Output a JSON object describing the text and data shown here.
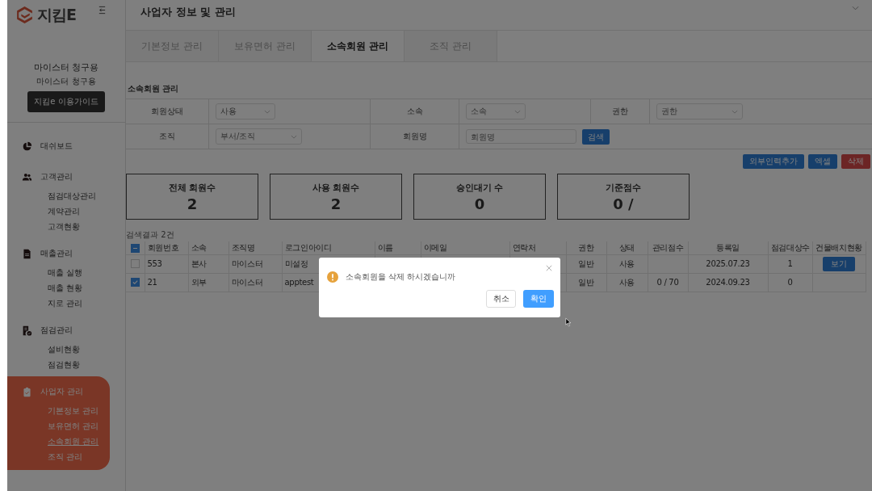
{
  "brand": {
    "name": "지킴E"
  },
  "account": {
    "name": "마이스터 청구용",
    "sub": "마이스터 청구용",
    "guide_button": "지킴e 이용가이드"
  },
  "sidebar": {
    "groups": [
      {
        "label": "대쉬보드",
        "selected": false
      },
      {
        "label": "고객관리",
        "selected": false,
        "children": [
          {
            "label": "점검대상관리",
            "selected": false
          },
          {
            "label": "계약관리",
            "selected": false
          },
          {
            "label": "고객현황",
            "selected": false
          }
        ]
      },
      {
        "label": "매출관리",
        "selected": false,
        "children": [
          {
            "label": "매출 실행",
            "selected": false
          },
          {
            "label": "매출 현황",
            "selected": false
          },
          {
            "label": "지로 관리",
            "selected": false
          }
        ]
      },
      {
        "label": "점검관리",
        "selected": false,
        "children": [
          {
            "label": "설비현황",
            "selected": false
          },
          {
            "label": "점검현황",
            "selected": false
          }
        ]
      },
      {
        "label": "사업자 관리",
        "selected": true,
        "children": [
          {
            "label": "기본정보 관리",
            "selected": false
          },
          {
            "label": "보유면허 관리",
            "selected": false
          },
          {
            "label": "소속회원 관리",
            "selected": true
          },
          {
            "label": "조직 관리",
            "selected": false
          }
        ]
      }
    ]
  },
  "header": {
    "title": "사업자 정보 및 관리"
  },
  "tabs": [
    {
      "label": "기본정보 관리",
      "selected": false
    },
    {
      "label": "보유면허 관리",
      "selected": false
    },
    {
      "label": "소속회원 관리",
      "selected": true
    },
    {
      "label": "조직 관리",
      "selected": false
    }
  ],
  "section_title": "소속회원 관리",
  "filters": [
    [
      {
        "label": "회원상태",
        "kind": "select",
        "value": "사용"
      },
      {
        "label": "소속",
        "kind": "select",
        "placeholder": "소속"
      },
      {
        "label": "권한",
        "kind": "select",
        "placeholder": "권한"
      }
    ],
    [
      {
        "label": "조직",
        "kind": "select",
        "placeholder": "부서/조직"
      },
      {
        "label": "회원명",
        "kind": "input",
        "placeholder": "회원명"
      }
    ]
  ],
  "search_button": "검색",
  "actions": [
    {
      "label": "외부인력추가",
      "kind": "primary"
    },
    {
      "label": "엑셀",
      "kind": "primary"
    },
    {
      "label": "삭제",
      "kind": "danger"
    }
  ],
  "stats": [
    {
      "label": "전체 회원수",
      "value": "2"
    },
    {
      "label": "사용 회원수",
      "value": "2"
    },
    {
      "label": "승인대기 수",
      "value": "0"
    },
    {
      "label": "기준점수",
      "value": "0 /"
    }
  ],
  "result_count": "검색결과 2건",
  "table": {
    "select_all_indeterminate": true,
    "columns": [
      "회원번호",
      "소속",
      "조직명",
      "로그인아이디",
      "이름",
      "이메일",
      "연락처",
      "권한",
      "상태",
      "관리점수",
      "등록일",
      "점검대상수",
      "건물배치현황"
    ],
    "rows": [
      {
        "checked": false,
        "cells": [
          "553",
          "본사",
          "마이스터",
          "미설정",
          null,
          null,
          null,
          "일반",
          "사용",
          null,
          "2025.07.23",
          "1"
        ],
        "action": "보기"
      },
      {
        "checked": true,
        "cells": [
          "21",
          "외부",
          "마이스터",
          "apptest",
          null,
          null,
          null,
          "일반",
          "사용",
          "0 / 70",
          "2024.09.23",
          "0"
        ]
      }
    ]
  },
  "dialog": {
    "message": "소속회원을 삭제 하시겠습니까",
    "cancel": "취소",
    "confirm": "확인"
  }
}
